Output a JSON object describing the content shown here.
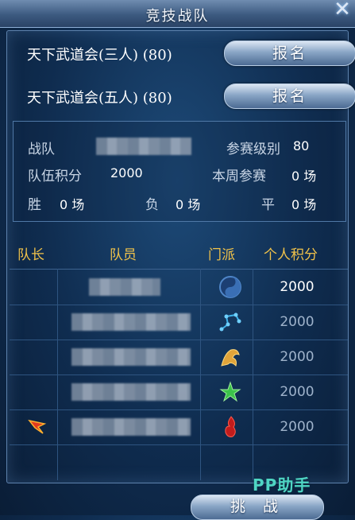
{
  "window": {
    "title": "竞技战队"
  },
  "signup": [
    {
      "label": "天下武道会(三人) (80)",
      "button": "报名"
    },
    {
      "label": "天下武道会(五人) (80)",
      "button": "报名"
    }
  ],
  "info": {
    "team_label": "战队",
    "level_label": "参赛级别",
    "level_value": "80",
    "points_label": "队伍积分",
    "points_value": "2000",
    "week_label": "本周参赛",
    "week_value": "0 场",
    "win_label": "胜",
    "win_value": "0 场",
    "loss_label": "负",
    "loss_value": "0 场",
    "draw_label": "平",
    "draw_value": "0 场"
  },
  "table": {
    "headers": {
      "captain": "队长",
      "member": "队员",
      "sect": "门派",
      "score": "个人积分"
    },
    "rows": [
      {
        "sect_icon": "taiji-icon",
        "score": "2000"
      },
      {
        "sect_icon": "constellation-icon",
        "score": "2000"
      },
      {
        "sect_icon": "golden-beast-icon",
        "score": "2000"
      },
      {
        "sect_icon": "green-leaf-icon",
        "score": "2000"
      },
      {
        "sect_icon": "red-flame-icon",
        "score": "2000",
        "captain_icon": "captain-flag-icon"
      }
    ]
  },
  "footer": {
    "watermark": "PP助手",
    "challenge": "挑 战"
  }
}
